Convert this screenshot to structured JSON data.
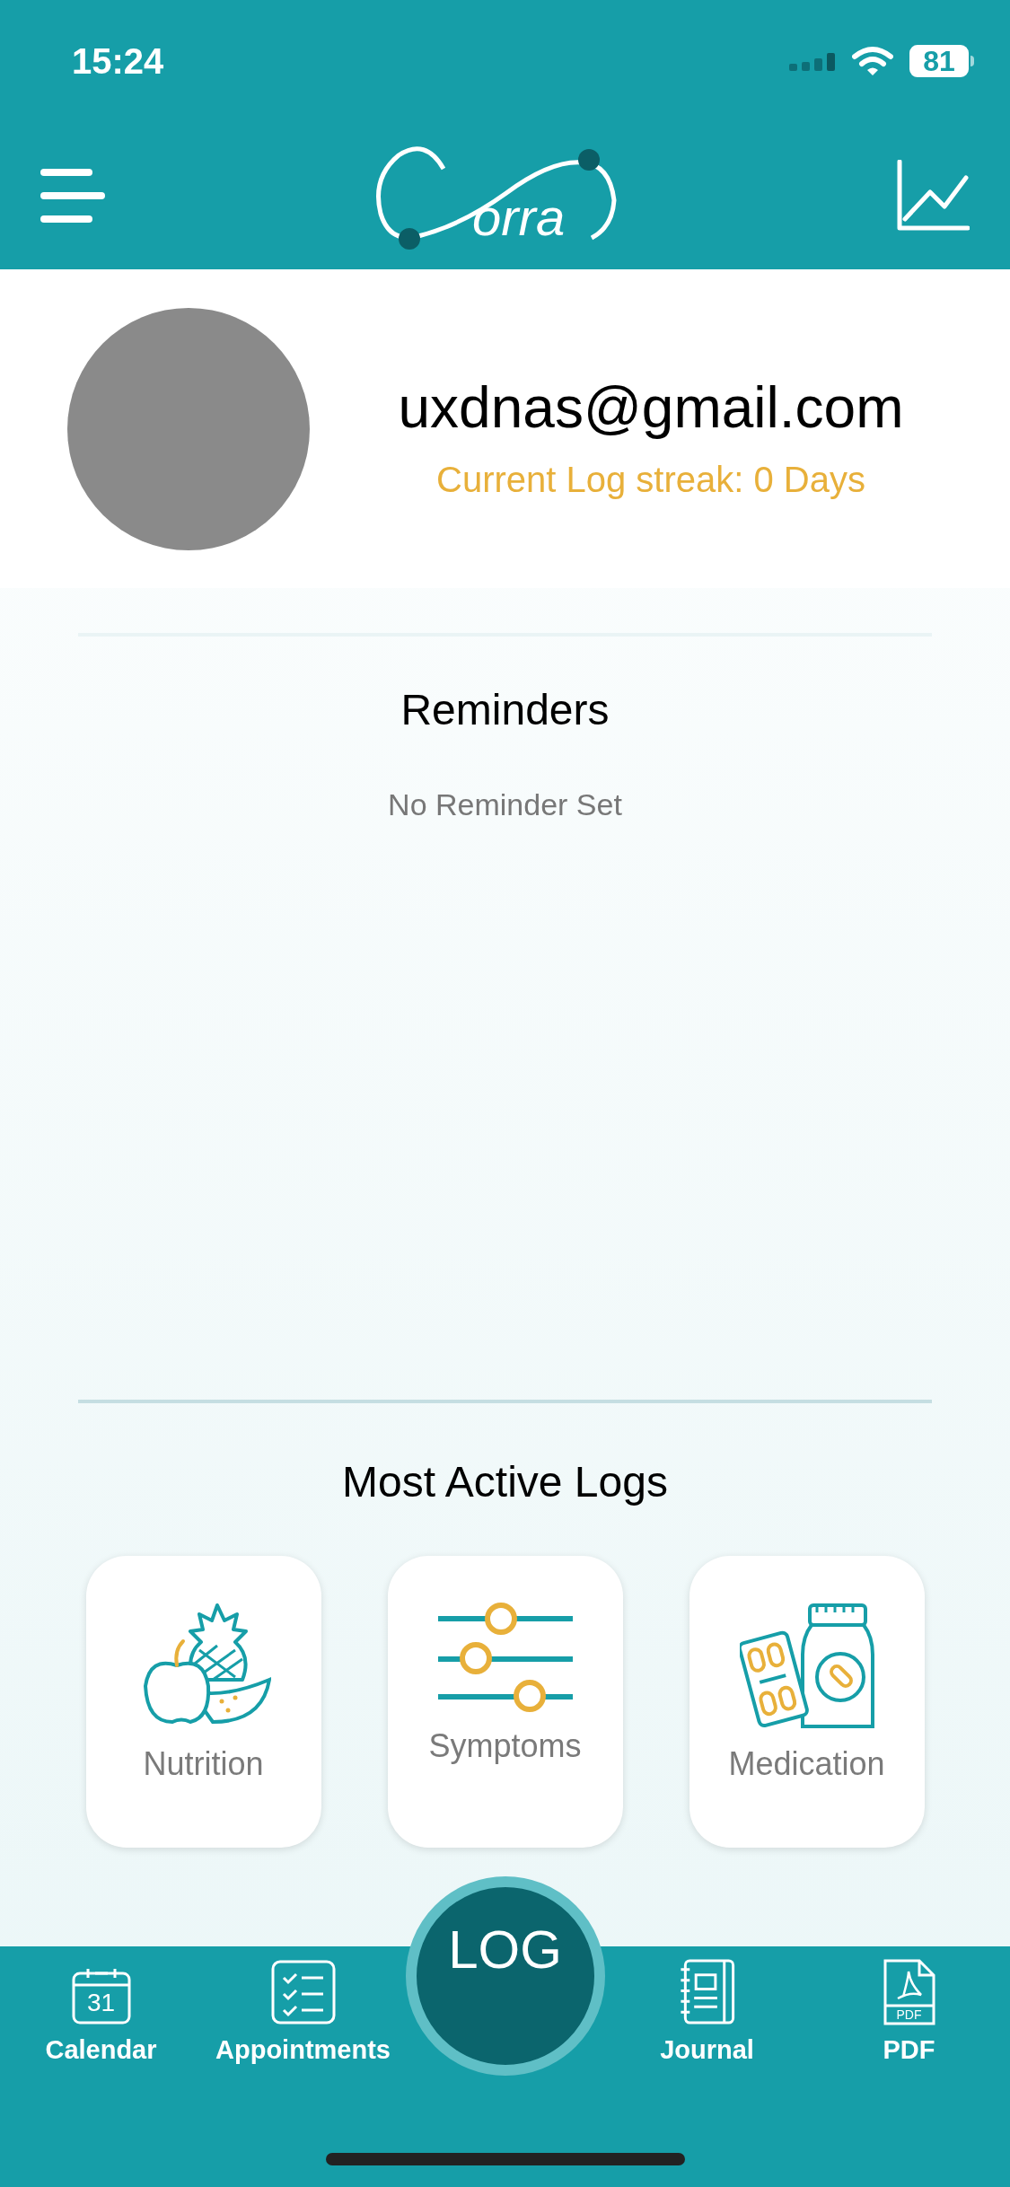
{
  "status_bar": {
    "time": "15:24",
    "battery": "81"
  },
  "header": {
    "logo_text": "orra"
  },
  "profile": {
    "email": "uxdnas@gmail.com",
    "streak": "Current Log streak: 0 Days"
  },
  "reminders": {
    "title": "Reminders",
    "empty_text": "No Reminder Set"
  },
  "most_active_logs": {
    "title": "Most Active Logs",
    "items": [
      {
        "label": "Nutrition",
        "kind": "nutrition"
      },
      {
        "label": "Symptoms",
        "kind": "symptoms"
      },
      {
        "label": "Medication",
        "kind": "medication"
      }
    ]
  },
  "tab_bar": {
    "items": [
      {
        "label": "Calendar",
        "kind": "calendar",
        "icon_text": "31"
      },
      {
        "label": "Appointments",
        "kind": "appointments"
      },
      {
        "label": "LOG",
        "kind": "log"
      },
      {
        "label": "Journal",
        "kind": "journal"
      },
      {
        "label": "PDF",
        "kind": "pdf",
        "icon_text": "PDF"
      }
    ]
  }
}
